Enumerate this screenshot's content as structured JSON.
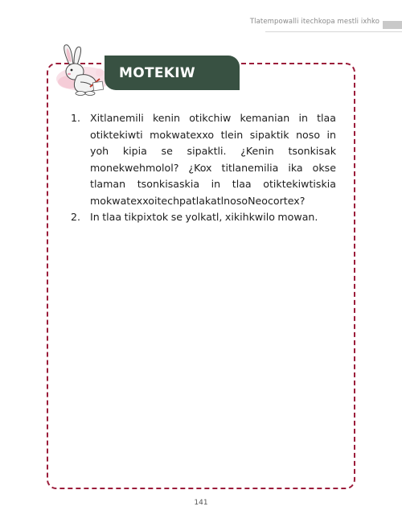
{
  "running_header": "Tlatempowalli itechkopa mestli ixhko",
  "activity": {
    "title": "MOTEKIW",
    "questions": [
      {
        "number": "1.",
        "text": "Xitlanemili kenin otikchiw kemanian in tlaa otiktekiwti mokwatexxo tlein sipaktik noso in yoh kipia se sipaktli. ¿Kenin tsonkisak monekwehmolol? ¿Kox titlanemilia ika okse tlaman tsonkisaskia in tlaa otiktekiwtiskia mokwatexxoitechpatlakatlnosoNeocortex?"
      },
      {
        "number": "2.",
        "text": "In tlaa tikpixtok se yolkatl, xikihkwilo mowan."
      }
    ]
  },
  "page_number": "141",
  "colors": {
    "banner": "#385142",
    "frame_dash": "#9b1c3a",
    "header_text": "#8a8a8a"
  },
  "icons": {
    "mascot": "rabbit-writing-illustration"
  }
}
